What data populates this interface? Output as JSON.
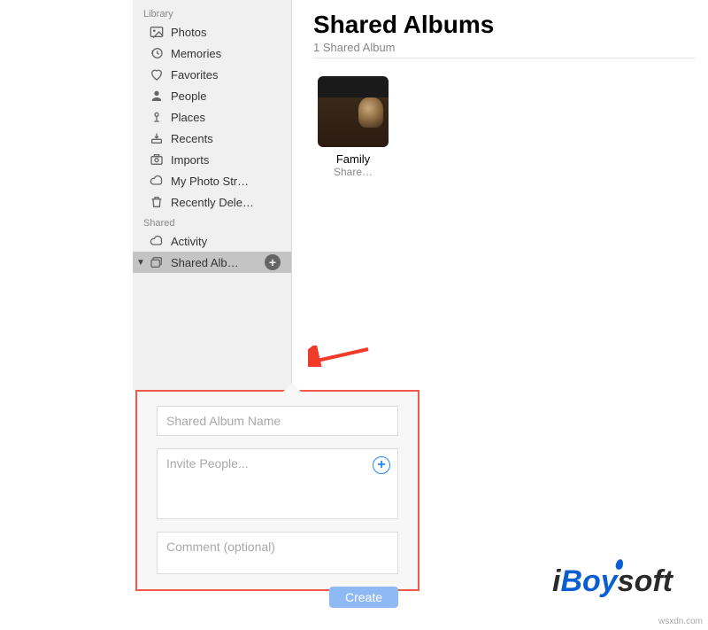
{
  "sidebar": {
    "sections": [
      {
        "header": "Library",
        "items": [
          {
            "label": "Photos"
          },
          {
            "label": "Memories"
          },
          {
            "label": "Favorites"
          },
          {
            "label": "People"
          },
          {
            "label": "Places"
          },
          {
            "label": "Recents"
          },
          {
            "label": "Imports"
          },
          {
            "label": "My Photo Str…"
          },
          {
            "label": "Recently Dele…"
          }
        ]
      },
      {
        "header": "Shared",
        "items": [
          {
            "label": "Activity"
          },
          {
            "label": "Shared Alb…"
          }
        ]
      }
    ]
  },
  "main": {
    "title": "Shared Albums",
    "subtitle": "1 Shared Album",
    "album": {
      "name": "Family",
      "sub": "Share…"
    }
  },
  "popover": {
    "name_placeholder": "Shared Album Name",
    "invite_placeholder": "Invite People...",
    "comment_placeholder": "Comment (optional)",
    "create_label": "Create"
  },
  "watermark": {
    "i": "i",
    "boy": "Boy",
    "soft": "soft"
  },
  "corner": "wsxdn.com"
}
